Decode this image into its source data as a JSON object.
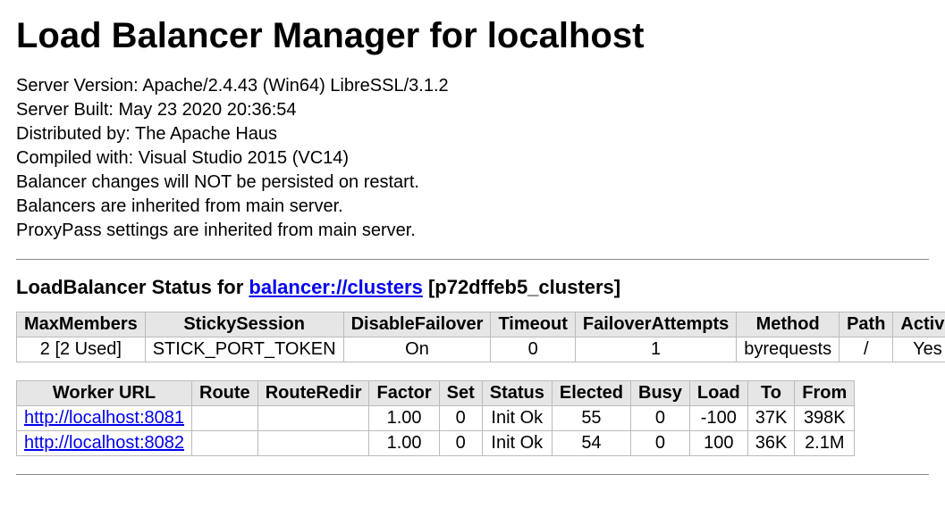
{
  "title": "Load Balancer Manager for localhost",
  "meta": {
    "server_version_label": "Server Version:",
    "server_version": "Apache/2.4.43 (Win64) LibreSSL/3.1.2",
    "server_built_label": "Server Built:",
    "server_built": "May 23 2020 20:36:54",
    "distributed_by_label": "Distributed by:",
    "distributed_by": "The Apache Haus",
    "compiled_with_label": "Compiled with:",
    "compiled_with": "Visual Studio 2015 (VC14)",
    "persist_note": "Balancer changes will NOT be persisted on restart.",
    "inherit_note": "Balancers are inherited from main server.",
    "proxypass_note": "ProxyPass settings are inherited from main server."
  },
  "status_heading": {
    "prefix": "LoadBalancer Status for ",
    "link": "balancer://clusters",
    "suffix": " [p72dffeb5_clusters]"
  },
  "balancer_table": {
    "headers": {
      "max_members": "MaxMembers",
      "sticky_session": "StickySession",
      "disable_failover": "DisableFailover",
      "timeout": "Timeout",
      "failover_attempts": "FailoverAttempts",
      "method": "Method",
      "path": "Path",
      "active": "Active"
    },
    "row": {
      "max_members": "2 [2 Used]",
      "sticky_session": "STICK_PORT_TOKEN",
      "disable_failover": "On",
      "timeout": "0",
      "failover_attempts": "1",
      "method": "byrequests",
      "path": "/",
      "active": "Yes"
    }
  },
  "worker_table": {
    "headers": {
      "worker_url": "Worker URL",
      "route": "Route",
      "route_redir": "RouteRedir",
      "factor": "Factor",
      "set": "Set",
      "status": "Status",
      "elected": "Elected",
      "busy": "Busy",
      "load": "Load",
      "to": "To",
      "from": "From"
    },
    "rows": [
      {
        "worker_url": "http://localhost:8081",
        "route": "",
        "route_redir": "",
        "factor": "1.00",
        "set": "0",
        "status": "Init Ok",
        "elected": "55",
        "busy": "0",
        "load": "-100",
        "to": "37K",
        "from": "398K"
      },
      {
        "worker_url": "http://localhost:8082",
        "route": "",
        "route_redir": "",
        "factor": "1.00",
        "set": "0",
        "status": "Init Ok",
        "elected": "54",
        "busy": "0",
        "load": "100",
        "to": "36K",
        "from": "2.1M"
      }
    ]
  }
}
